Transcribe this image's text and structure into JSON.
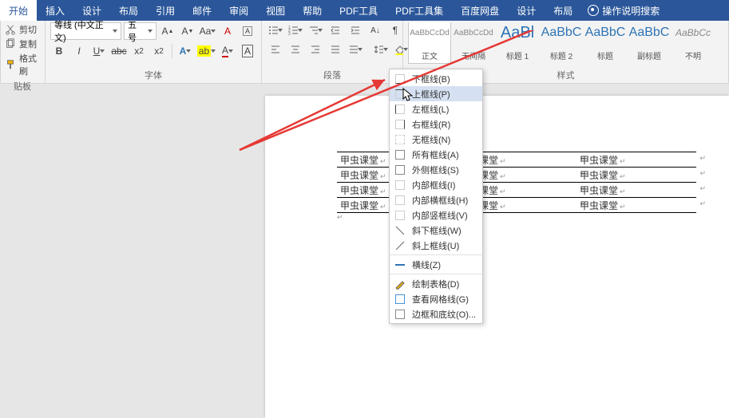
{
  "tabs": [
    "开始",
    "插入",
    "设计",
    "布局",
    "引用",
    "邮件",
    "审阅",
    "视图",
    "帮助",
    "PDF工具",
    "PDF工具集",
    "百度网盘",
    "设计",
    "布局"
  ],
  "tell_me": "操作说明搜索",
  "clipboard": {
    "cut": "剪切",
    "copy": "复制",
    "paint": "格式刷",
    "label": "贴板"
  },
  "font": {
    "name": "等线 (中文正文)",
    "size": "五号",
    "label": "字体"
  },
  "paragraph": {
    "label": "段落"
  },
  "styles": {
    "label": "样式",
    "items": [
      {
        "prev": "AaBbCcDd",
        "name": "正文",
        "small": true
      },
      {
        "prev": "AaBbCcDd",
        "name": "无间隔",
        "small": true
      },
      {
        "prev": "AaBl",
        "name": "标题 1",
        "blue": true
      },
      {
        "prev": "AaBbC",
        "name": "标题 2",
        "blue": true
      },
      {
        "prev": "AaBbC",
        "name": "标题",
        "blue": true
      },
      {
        "prev": "AaBbC",
        "name": "副标题",
        "blue": true
      },
      {
        "prev": "AaBbCc",
        "name": "不明",
        "small": true
      }
    ]
  },
  "dropdown": {
    "items": [
      {
        "t": "下框线(B)"
      },
      {
        "t": "上框线(P)",
        "hover": true
      },
      {
        "t": "左框线(L)"
      },
      {
        "t": "右框线(R)"
      },
      {
        "t": "无框线(N)"
      },
      {
        "t": "所有框线(A)"
      },
      {
        "t": "外侧框线(S)"
      },
      {
        "t": "内部框线(I)"
      },
      {
        "t": "内部横框线(H)"
      },
      {
        "t": "内部竖框线(V)"
      },
      {
        "t": "斜下框线(W)"
      },
      {
        "t": "斜上框线(U)"
      },
      {
        "sep": true
      },
      {
        "t": "横线(Z)"
      },
      {
        "sep": true
      },
      {
        "t": "绘制表格(D)"
      },
      {
        "t": "查看网格线(G)"
      },
      {
        "t": "边框和底纹(O)..."
      }
    ]
  },
  "table": {
    "cell": "甲虫课堂"
  }
}
